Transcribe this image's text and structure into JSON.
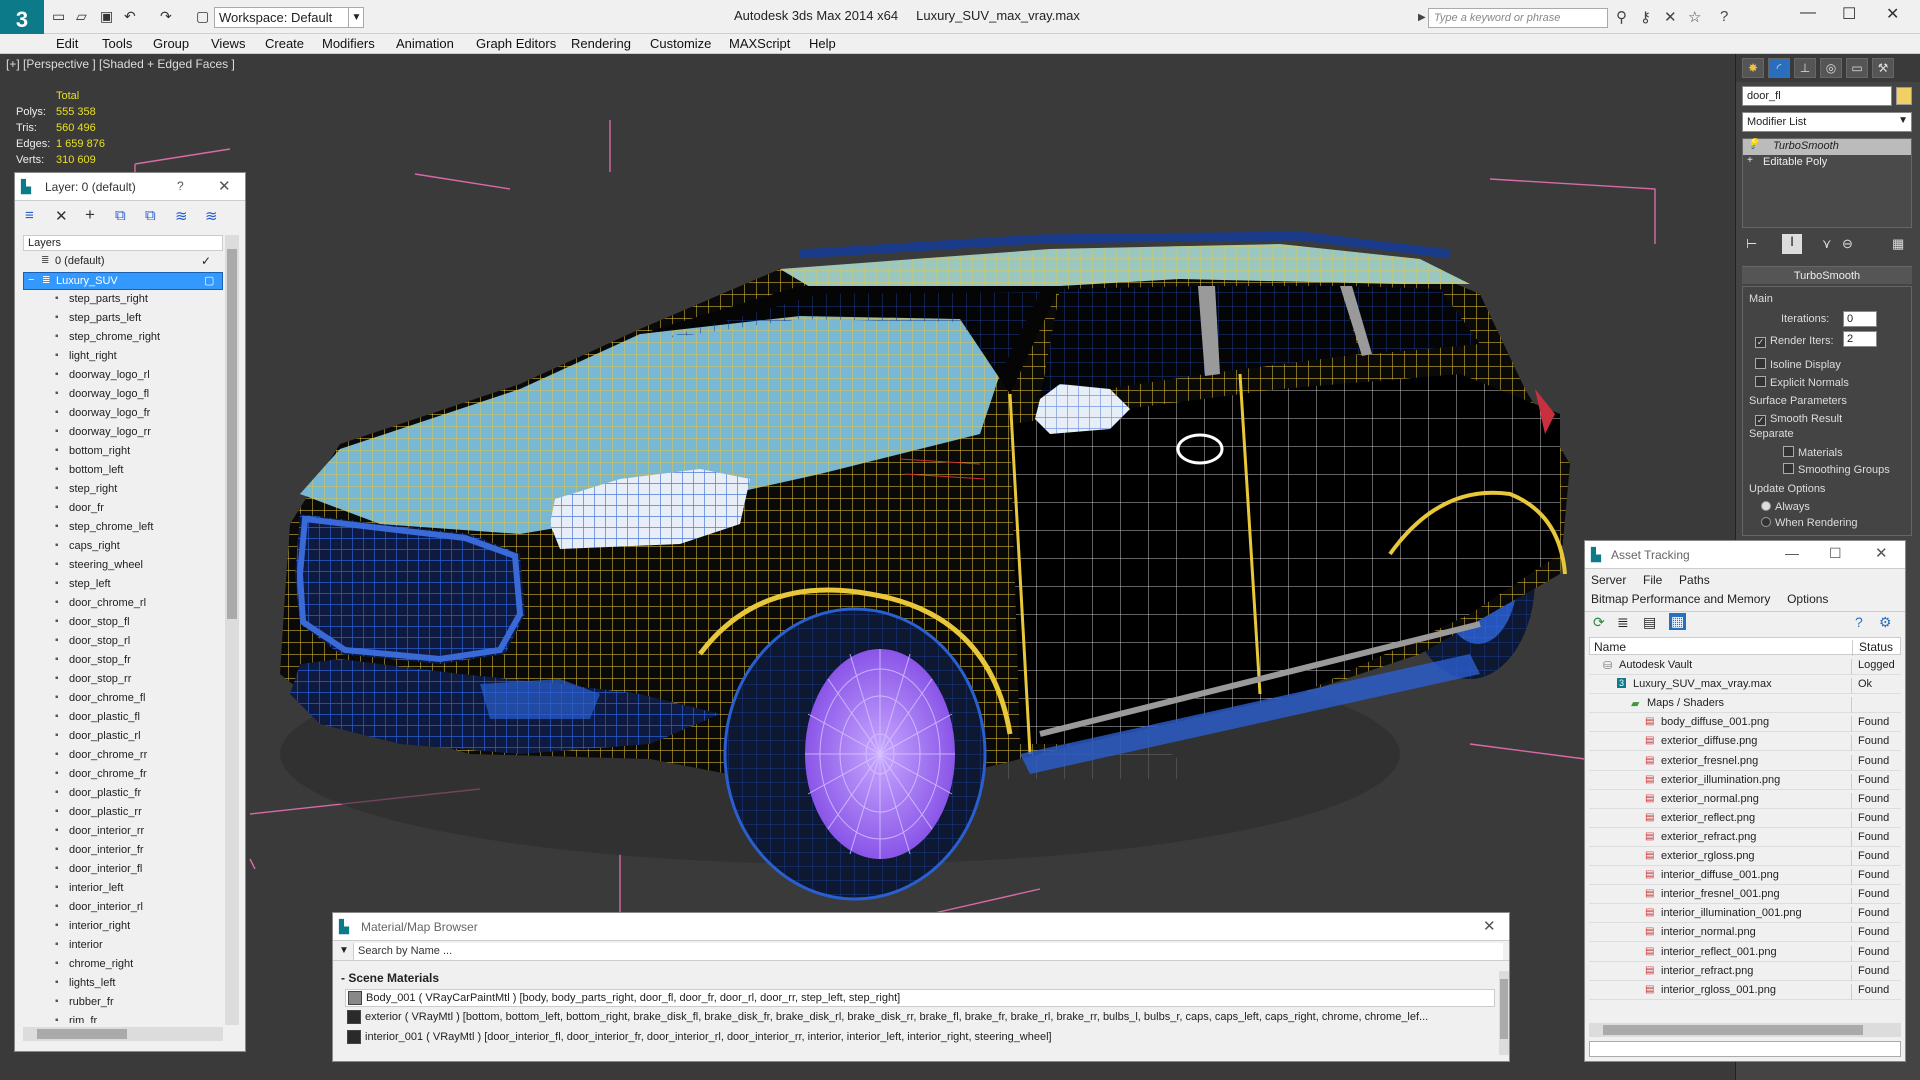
{
  "app": {
    "title": "Autodesk 3ds Max  2014 x64",
    "file": "Luxury_SUV_max_vray.max",
    "workspace": "Workspace: Default",
    "search_placeholder": "Type a keyword or phrase"
  },
  "menu": [
    "Edit",
    "Tools",
    "Group",
    "Views",
    "Create",
    "Modifiers",
    "Animation",
    "Graph Editors",
    "Rendering",
    "Customize",
    "MAXScript",
    "Help"
  ],
  "viewport": {
    "label": "[+] [Perspective ] [Shaded + Edged Faces ]",
    "stats": {
      "header": "Total",
      "rows": [
        {
          "k": "Polys:",
          "v": "555 358"
        },
        {
          "k": "Tris:",
          "v": "560 496"
        },
        {
          "k": "Edges:",
          "v": "1 659 876"
        },
        {
          "k": "Verts:",
          "v": "310 609"
        }
      ]
    }
  },
  "layer_panel": {
    "title": "Layer: 0 (default)",
    "help": "?",
    "column": "Layers",
    "items": [
      "0 (default)",
      "Luxury_SUV",
      "step_parts_right",
      "step_parts_left",
      "step_chrome_right",
      "light_right",
      "doorway_logo_rl",
      "doorway_logo_fl",
      "doorway_logo_fr",
      "doorway_logo_rr",
      "bottom_right",
      "bottom_left",
      "step_right",
      "door_fr",
      "step_chrome_left",
      "caps_right",
      "steering_wheel",
      "step_left",
      "door_chrome_rl",
      "door_stop_fl",
      "door_stop_rl",
      "door_stop_fr",
      "door_stop_rr",
      "door_chrome_fl",
      "door_plastic_fl",
      "door_plastic_rl",
      "door_chrome_rr",
      "door_chrome_fr",
      "door_plastic_fr",
      "door_plastic_rr",
      "door_interior_rr",
      "door_interior_fr",
      "door_interior_fl",
      "interior_left",
      "door_interior_rl",
      "interior_right",
      "interior",
      "chrome_right",
      "lights_left",
      "rubber_fr",
      "rim_fr"
    ],
    "selected_index": 1
  },
  "command_panel": {
    "object_name": "door_fl",
    "modifier_list": "Modifier List",
    "stack": [
      "TurboSmooth",
      "Editable Poly"
    ],
    "rollout_title": "TurboSmooth",
    "main_label": "Main",
    "iterations_label": "Iterations:",
    "iterations_value": "0",
    "render_iters_label": "Render Iters:",
    "render_iters_value": "2",
    "isoline": "Isoline Display",
    "explicit": "Explicit Normals",
    "surface_params": "Surface Parameters",
    "smooth_result": "Smooth Result",
    "separate": "Separate",
    "materials": "Materials",
    "smoothing_groups": "Smoothing Groups",
    "update_options": "Update Options",
    "always": "Always",
    "when_rendering": "When Rendering"
  },
  "asset_tracking": {
    "title": "Asset Tracking",
    "menu1": [
      "Server",
      "File",
      "Paths"
    ],
    "menu2": [
      "Bitmap Performance and Memory",
      "Options"
    ],
    "col_name": "Name",
    "col_status": "Status",
    "rows": [
      {
        "name": "Autodesk Vault",
        "status": "Logged",
        "indent": 1,
        "type": "vault"
      },
      {
        "name": "Luxury_SUV_max_vray.max",
        "status": "Ok",
        "indent": 2,
        "type": "max"
      },
      {
        "name": "Maps / Shaders",
        "status": "",
        "indent": 3,
        "type": "folder"
      },
      {
        "name": "body_diffuse_001.png",
        "status": "Found",
        "indent": 4,
        "type": "png"
      },
      {
        "name": "exterior_diffuse.png",
        "status": "Found",
        "indent": 4,
        "type": "png"
      },
      {
        "name": "exterior_fresnel.png",
        "status": "Found",
        "indent": 4,
        "type": "png"
      },
      {
        "name": "exterior_illumination.png",
        "status": "Found",
        "indent": 4,
        "type": "png"
      },
      {
        "name": "exterior_normal.png",
        "status": "Found",
        "indent": 4,
        "type": "png"
      },
      {
        "name": "exterior_reflect.png",
        "status": "Found",
        "indent": 4,
        "type": "png"
      },
      {
        "name": "exterior_refract.png",
        "status": "Found",
        "indent": 4,
        "type": "png"
      },
      {
        "name": "exterior_rgloss.png",
        "status": "Found",
        "indent": 4,
        "type": "png"
      },
      {
        "name": "interior_diffuse_001.png",
        "status": "Found",
        "indent": 4,
        "type": "png"
      },
      {
        "name": "interior_fresnel_001.png",
        "status": "Found",
        "indent": 4,
        "type": "png"
      },
      {
        "name": "interior_illumination_001.png",
        "status": "Found",
        "indent": 4,
        "type": "png"
      },
      {
        "name": "interior_normal.png",
        "status": "Found",
        "indent": 4,
        "type": "png"
      },
      {
        "name": "interior_reflect_001.png",
        "status": "Found",
        "indent": 4,
        "type": "png"
      },
      {
        "name": "interior_refract.png",
        "status": "Found",
        "indent": 4,
        "type": "png"
      },
      {
        "name": "interior_rgloss_001.png",
        "status": "Found",
        "indent": 4,
        "type": "png"
      }
    ]
  },
  "material_browser": {
    "title": "Material/Map Browser",
    "search_placeholder": "Search by Name ...",
    "section": "- Scene Materials",
    "rows": [
      "Body_001 ( VRayCarPaintMtl ) [body, body_parts_right, door_fl, door_fr, door_rl, door_rr, step_left, step_right]",
      "exterior ( VRayMtl ) [bottom, bottom_left, bottom_right, brake_disk_fl, brake_disk_fr, brake_disk_rl, brake_disk_rr, brake_fl, brake_fr, brake_rl, brake_rr, bulbs_l, bulbs_r, caps, caps_left, caps_right, chrome, chrome_lef...",
      "interior_001 ( VRayMtl ) [door_interior_fl, door_interior_fr, door_interior_rl, door_interior_rr, interior, interior_left, interior_right, steering_wheel]"
    ]
  },
  "colors": {
    "accent": "#0d7a8a",
    "stats": "#e8e020",
    "selection": "#3399ff",
    "wire_yellow": "#e8c83a",
    "wire_blue": "#2a5fd0",
    "rim": "#9966ee"
  }
}
